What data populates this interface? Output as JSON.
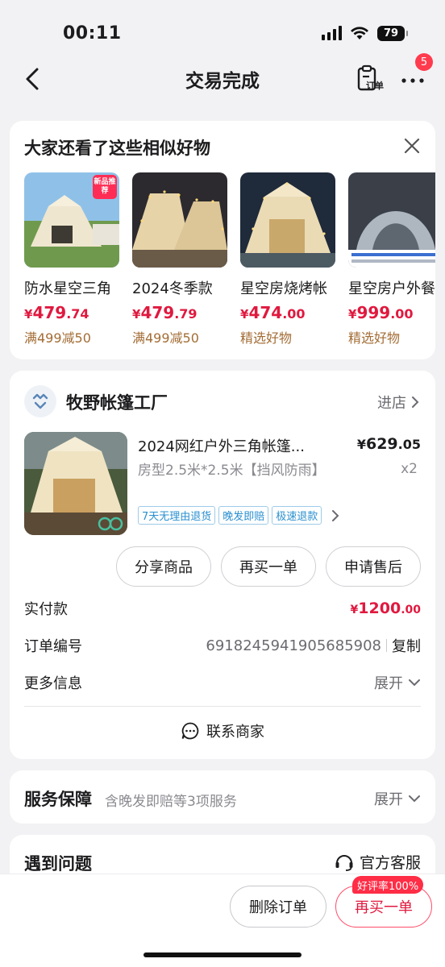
{
  "status_bar": {
    "time": "00:11",
    "battery": "79"
  },
  "nav": {
    "title": "交易完成",
    "order_label": "订单",
    "badge_count": "5"
  },
  "recommendations": {
    "title": "大家还看了这些相似好物",
    "items": [
      {
        "name": "防水星空三角",
        "price_int": "479",
        "price_dec": ".74",
        "tag": "满499减50",
        "badge": "新品推荐"
      },
      {
        "name": "2024冬季款",
        "price_int": "479",
        "price_dec": ".79",
        "tag": "满499减50"
      },
      {
        "name": "星空房烧烤帐",
        "price_int": "474",
        "price_dec": ".00",
        "tag": "精选好物"
      },
      {
        "name": "星空房户外餐",
        "price_int": "999",
        "price_dec": ".00",
        "tag": "精选好物"
      }
    ]
  },
  "currency": "¥",
  "order": {
    "shop_name": "牧野帐篷工厂",
    "enter_shop": "进店",
    "product": {
      "title": "2024网红户外三角帐篷...",
      "price_int": "629",
      "price_dec": ".05",
      "spec": "房型2.5米*2.5米【挡风防雨】",
      "quantity": "x2",
      "tags": [
        "7天无理由退货",
        "晚发即赔",
        "极速退款"
      ]
    },
    "actions": [
      "分享商品",
      "再买一单",
      "申请售后"
    ],
    "paid_label": "实付款",
    "paid_int": "1200",
    "paid_dec": ".00",
    "order_no_label": "订单编号",
    "order_no": "6918245941905685908",
    "copy_label": "复制",
    "more_info_label": "更多信息",
    "expand_label": "展开",
    "contact_label": "联系商家"
  },
  "service": {
    "label": "服务保障",
    "desc": "含晚发即赔等3项服务",
    "expand": "展开"
  },
  "problem": {
    "label": "遇到问题",
    "customer_service": "官方客服"
  },
  "bottom": {
    "delete_label": "删除订单",
    "rebuy_label": "再买一单",
    "rating_badge": "好评率100%"
  }
}
